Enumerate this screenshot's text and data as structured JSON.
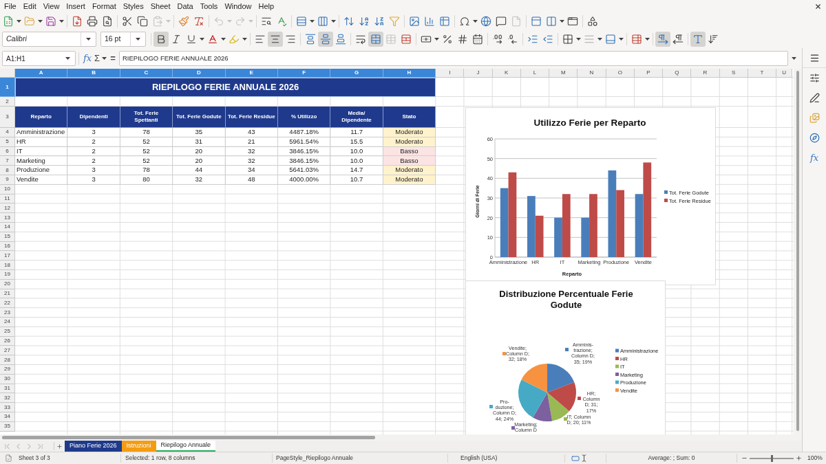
{
  "menu_bar": {
    "items": [
      "File",
      "Edit",
      "View",
      "Insert",
      "Format",
      "Styles",
      "Sheet",
      "Data",
      "Tools",
      "Window",
      "Help"
    ]
  },
  "standard_toolbar": {
    "paste_disabled": true,
    "undo_disabled": true,
    "redo_disabled": true,
    "header_footer_disabled": true
  },
  "formatting_toolbar": {
    "font_name": "Calibri",
    "font_size": "16 pt",
    "bold": true,
    "italic": false,
    "underline": false,
    "align_left": false,
    "align_center": true,
    "align_right": false,
    "align_top": false,
    "align_middle": true,
    "align_bottom": false,
    "wrap_text": false,
    "merge_and_center": true,
    "merge_cells_disabled": true,
    "left_to_right": true,
    "right_to_left": false,
    "text_horizontal": true,
    "text_vertical": false
  },
  "formula_bar": {
    "name_box": "A1:H1",
    "function_wizard": "fx",
    "sum": "Σ",
    "equals": "=",
    "content": "RIEPILOGO FERIE ANNUALE 2026"
  },
  "sheet": {
    "column_headers": [
      {
        "label": "A",
        "selected": true
      },
      {
        "label": "B",
        "selected": true
      },
      {
        "label": "C",
        "selected": true
      },
      {
        "label": "D",
        "selected": true
      },
      {
        "label": "E",
        "selected": true
      },
      {
        "label": "F",
        "selected": true
      },
      {
        "label": "G",
        "selected": true
      },
      {
        "label": "H",
        "selected": true
      },
      {
        "label": "I",
        "selected": false
      },
      {
        "label": "J",
        "selected": false
      },
      {
        "label": "K",
        "selected": false
      },
      {
        "label": "L",
        "selected": false
      },
      {
        "label": "M",
        "selected": false
      },
      {
        "label": "N",
        "selected": false
      },
      {
        "label": "O",
        "selected": false
      },
      {
        "label": "P",
        "selected": false
      },
      {
        "label": "Q",
        "selected": false
      },
      {
        "label": "R",
        "selected": false
      },
      {
        "label": "S",
        "selected": false
      },
      {
        "label": "T",
        "selected": false
      },
      {
        "label": "U",
        "selected": false
      }
    ],
    "row_headers": [
      {
        "label": "1",
        "selected": true
      },
      {
        "label": "2",
        "selected": false
      },
      {
        "label": "3",
        "selected": false
      },
      {
        "label": "4",
        "selected": false
      },
      {
        "label": "5",
        "selected": false
      },
      {
        "label": "6",
        "selected": false
      },
      {
        "label": "7",
        "selected": false
      },
      {
        "label": "8",
        "selected": false
      },
      {
        "label": "9",
        "selected": false
      },
      {
        "label": "10",
        "selected": false
      },
      {
        "label": "11",
        "selected": false
      },
      {
        "label": "12",
        "selected": false
      },
      {
        "label": "13",
        "selected": false
      },
      {
        "label": "14",
        "selected": false
      },
      {
        "label": "15",
        "selected": false
      },
      {
        "label": "16",
        "selected": false
      },
      {
        "label": "17",
        "selected": false
      },
      {
        "label": "18",
        "selected": false
      },
      {
        "label": "19",
        "selected": false
      },
      {
        "label": "20",
        "selected": false
      },
      {
        "label": "21",
        "selected": false
      },
      {
        "label": "22",
        "selected": false
      },
      {
        "label": "23",
        "selected": false
      },
      {
        "label": "24",
        "selected": false
      },
      {
        "label": "25",
        "selected": false
      },
      {
        "label": "26",
        "selected": false
      },
      {
        "label": "27",
        "selected": false
      },
      {
        "label": "28",
        "selected": false
      },
      {
        "label": "29",
        "selected": false
      },
      {
        "label": "30",
        "selected": false
      },
      {
        "label": "31",
        "selected": false
      },
      {
        "label": "32",
        "selected": false
      },
      {
        "label": "33",
        "selected": false
      },
      {
        "label": "34",
        "selected": false
      },
      {
        "label": "35",
        "selected": false
      }
    ],
    "title": "RIEPILOGO FERIE ANNUALE 2026",
    "table": {
      "headers": [
        "Reparto",
        "Dipendenti",
        "Tot. Ferie Spettanti",
        "Tot. Ferie Godute",
        "Tot. Ferie Residue",
        "% Utilizzo",
        "Media/ Dipendente",
        "Stato"
      ],
      "rows": [
        {
          "cells": [
            "Amministrazione",
            "3",
            "78",
            "35",
            "43",
            "4487.18%",
            "11.7",
            "Moderato"
          ],
          "color": "#fff2cc"
        },
        {
          "cells": [
            "HR",
            "2",
            "52",
            "31",
            "21",
            "5961.54%",
            "15.5",
            "Moderato"
          ],
          "color": "#fff2cc"
        },
        {
          "cells": [
            "IT",
            "2",
            "52",
            "20",
            "32",
            "3846.15%",
            "10.0",
            "Basso"
          ],
          "color": "#fce4e4"
        },
        {
          "cells": [
            "Marketing",
            "2",
            "52",
            "20",
            "32",
            "3846.15%",
            "10.0",
            "Basso"
          ],
          "color": "#fce4e4"
        },
        {
          "cells": [
            "Produzione",
            "3",
            "78",
            "44",
            "34",
            "5641.03%",
            "14.7",
            "Moderato"
          ],
          "color": "#fff2cc"
        },
        {
          "cells": [
            "Vendite",
            "3",
            "80",
            "32",
            "48",
            "4000.00%",
            "10.7",
            "Moderato"
          ],
          "color": "#fff2cc"
        }
      ]
    }
  },
  "charts": [
    {
      "chart_data": {
        "type": "bar",
        "title": "Utilizzo Ferie per Reparto",
        "xlabel": "Reparto",
        "ylabel": "Giorni di Ferie",
        "categories": [
          "Amministrazione",
          "HR",
          "IT",
          "Marketing",
          "Produzione",
          "Vendite"
        ],
        "series": [
          {
            "name": "Tot. Ferie Godute",
            "color": "#4a7ebb",
            "values": [
              35,
              31,
              20,
              20,
              44,
              32
            ]
          },
          {
            "name": "Tot. Ferie Residue",
            "color": "#be4b48",
            "values": [
              43,
              21,
              32,
              32,
              34,
              48
            ]
          }
        ],
        "ylim": [
          0,
          60
        ],
        "yticks": [
          0,
          10,
          20,
          30,
          40,
          50,
          60
        ],
        "grid": true,
        "legend": "right"
      }
    },
    {
      "chart_data": {
        "type": "pie",
        "title": "Distribuzione Percentuale Ferie Godute",
        "categories": [
          "Amministrazione",
          "HR",
          "IT",
          "Marketing",
          "Produzione",
          "Vendite"
        ],
        "values": [
          35,
          31,
          20,
          20,
          44,
          32
        ],
        "colors": [
          "#4a7ebb",
          "#be4b48",
          "#98b954",
          "#7d60a0",
          "#46aac5",
          "#f69240"
        ],
        "value_labels": [
          "Amminis-\ntrazione;\nColumn D;\n35; 19%",
          "HR;\nColumn\nD; 31;\n17%",
          "IT; Column\nD; 20; 11%",
          "Marketing;\nColumn D",
          "Pro-\nduzione;\nColumn D;\n44; 24%",
          "Vendite;\nColumn D;\n32; 18%"
        ],
        "legend": "right"
      }
    }
  ],
  "sheet_tabs": [
    {
      "label": "Piano Ferie 2026",
      "color": "#1f3a8a",
      "selected": false
    },
    {
      "label": "Istruzioni",
      "color": "#f39c12",
      "selected": false
    },
    {
      "label": "Riepilogo Annuale",
      "color": "#27ae60",
      "selected": true
    }
  ],
  "sidebar": {
    "functions": "fx"
  },
  "status_bar": {
    "sheet": "Sheet 3 of 3",
    "selection": "Selected: 1 row, 8 columns",
    "page_style": "PageStyle_Riepilogo Annuale",
    "language": "English (USA)",
    "summary": "Average: ; Sum: 0",
    "zoom_slider": {
      "level": 0.5
    },
    "zoom": "100%"
  }
}
